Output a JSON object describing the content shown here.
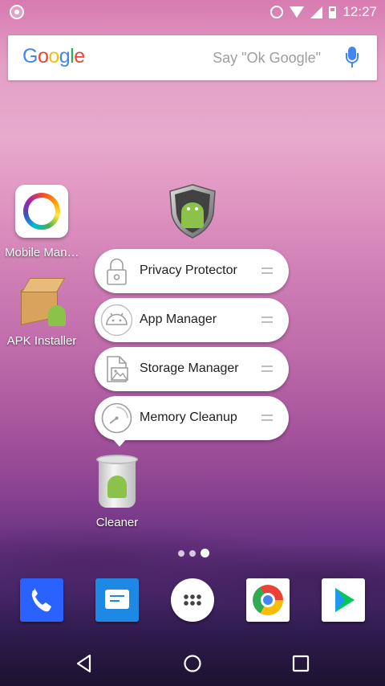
{
  "status_bar": {
    "time": "12:27",
    "icons": [
      "notification-icon",
      "alarm-icon",
      "wifi-icon",
      "signal-icon",
      "battery-icon"
    ]
  },
  "search_bar": {
    "logo": "Google",
    "hint": "Say \"Ok Google\"",
    "mic_icon": "mic-icon"
  },
  "home_apps": [
    {
      "label": "Mobile Man…",
      "icon": "mobile-manager-icon"
    },
    {
      "label": "APK Installer",
      "icon": "apk-installer-icon"
    }
  ],
  "security_app": {
    "icon": "android-shield-icon"
  },
  "shortcut_menu": {
    "items": [
      {
        "label": "Privacy Protector",
        "icon": "lock-icon"
      },
      {
        "label": "App Manager",
        "icon": "android-head-icon"
      },
      {
        "label": "Storage Manager",
        "icon": "file-image-icon"
      },
      {
        "label": "Memory Cleanup",
        "icon": "gauge-icon"
      }
    ]
  },
  "cleaner_app": {
    "label": "Cleaner",
    "icon": "trash-android-icon"
  },
  "page_indicator": {
    "pages": 3,
    "current": 3
  },
  "dock": [
    "phone-icon",
    "messages-icon",
    "app-drawer-icon",
    "chrome-icon",
    "play-store-icon"
  ],
  "nav_bar": [
    "back-icon",
    "home-icon",
    "recents-icon"
  ],
  "colors": {
    "google_blue": "#4285F4",
    "android_green": "#8BC34A"
  }
}
